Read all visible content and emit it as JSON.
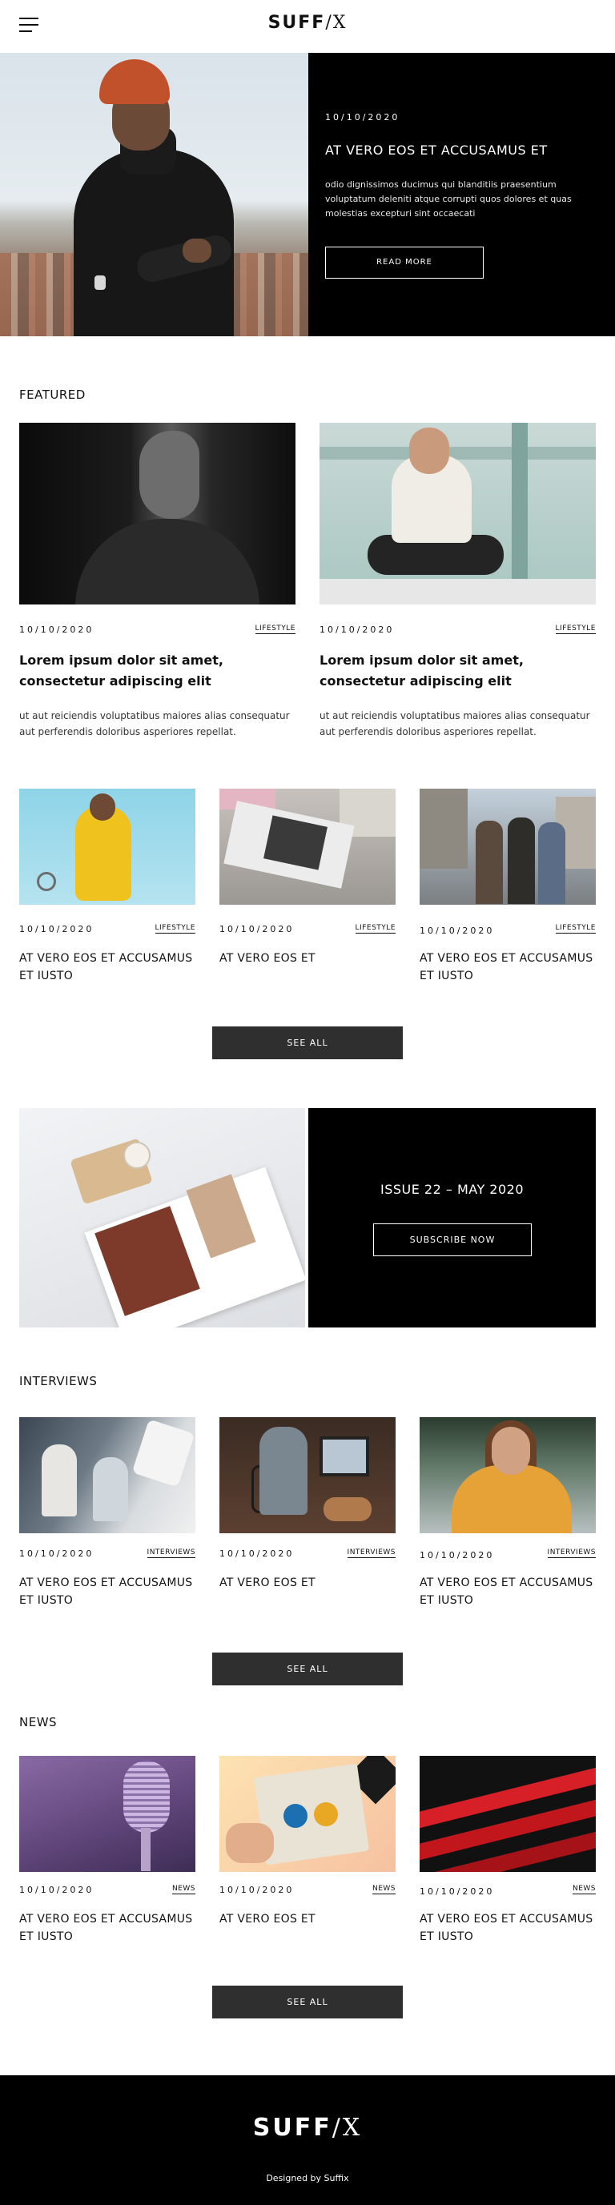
{
  "header": {
    "logo_part1": "SUFF",
    "logo_slash": "/",
    "logo_x": "X"
  },
  "hero": {
    "date": "10/10/2020",
    "title": "AT VERO EOS ET ACCUSAMUS ET",
    "text": "odio dignissimos ducimus qui blanditiis praesentium voluptatum deleniti atque corrupti quos dolores et quas molestias excepturi sint occaecati",
    "button": "READ MORE"
  },
  "featured": {
    "title": "FEATURED",
    "big": [
      {
        "date": "10/10/2020",
        "category": "LIFESTYLE",
        "title": "Lorem ipsum dolor sit amet, consectetur adipiscing elit",
        "text": "ut aut reiciendis voluptatibus maiores alias consequatur aut perferendis doloribus asperiores repellat."
      },
      {
        "date": "10/10/2020",
        "category": "LIFESTYLE",
        "title": "Lorem ipsum dolor sit amet, consectetur adipiscing elit",
        "text": "ut aut reiciendis voluptatibus maiores alias consequatur aut perferendis doloribus asperiores repellat."
      }
    ],
    "small": [
      {
        "date": "10/10/2020",
        "category": "LIFESTYLE",
        "title": "AT VERO EOS ET ACCUSAMUS ET IUSTO"
      },
      {
        "date": "10/10/2020",
        "category": "LIFESTYLE",
        "title": "AT VERO EOS ET"
      },
      {
        "date": "10/10/2020",
        "category": "LIFESTYLE",
        "title": "AT VERO EOS ET ACCUSAMUS ET IUSTO"
      }
    ],
    "see_all": "SEE ALL"
  },
  "issue": {
    "title": "ISSUE 22 – MAY 2020",
    "button": "SUBSCRIBE NOW"
  },
  "interviews": {
    "title": "INTERVIEWS",
    "items": [
      {
        "date": "10/10/2020",
        "category": "INTERVIEWS",
        "title": "AT VERO EOS ET ACCUSAMUS ET IUSTO"
      },
      {
        "date": "10/10/2020",
        "category": "INTERVIEWS",
        "title": "AT VERO EOS ET"
      },
      {
        "date": "10/10/2020",
        "category": "INTERVIEWS",
        "title": "AT VERO EOS ET ACCUSAMUS ET IUSTO"
      }
    ],
    "see_all": "SEE ALL"
  },
  "news": {
    "title": "NEWS",
    "items": [
      {
        "date": "10/10/2020",
        "category": "NEWS",
        "title": "AT VERO EOS ET ACCUSAMUS ET IUSTO"
      },
      {
        "date": "10/10/2020",
        "category": "NEWS",
        "title": "AT VERO EOS ET"
      },
      {
        "date": "10/10/2020",
        "category": "NEWS",
        "title": "AT VERO EOS ET ACCUSAMUS ET IUSTO"
      }
    ],
    "see_all": "SEE ALL"
  },
  "footer": {
    "logo_part1": "SUFF",
    "logo_slash": "/",
    "logo_x": "X",
    "credit": "Designed by Suffix"
  }
}
